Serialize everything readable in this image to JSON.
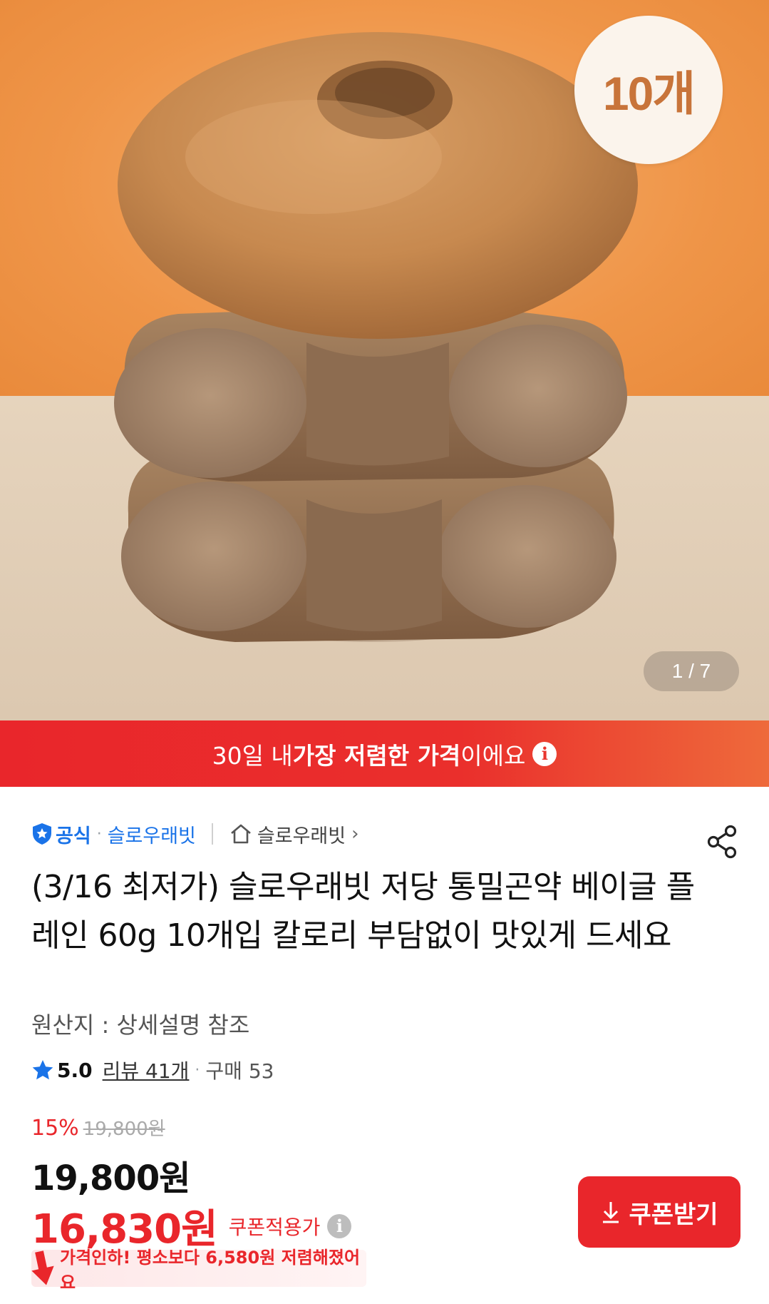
{
  "hero": {
    "count_badge": "10개",
    "page_indicator": "1 / 7"
  },
  "banner": {
    "text_before": "30일 내 ",
    "text_bold": "가장 저렴한 가격",
    "text_after": "이에요",
    "info_glyph": "i"
  },
  "store": {
    "official_label": "공식",
    "separator": "·",
    "store_name": "슬로우래빗",
    "home_store_name": "슬로우래빗",
    "chevron": "›"
  },
  "product": {
    "title": "(3/16 최저가) 슬로우래빗 저당 통밀곤약 베이글 플레인 60g 10개입 칼로리 부담없이 맛있게 드세요",
    "origin": "원산지 : 상세설명 참조"
  },
  "rating": {
    "score": "5.0",
    "review_link": "리뷰 41개",
    "separator": "·",
    "purchase_count": "구매 53"
  },
  "price": {
    "discount_rate": "15%",
    "original_price": "19,800원",
    "sale_price": "19,800원",
    "coupon_price": "16,830원",
    "coupon_label": "쿠폰적용가",
    "info_glyph": "i"
  },
  "coupon_button": {
    "label": "쿠폰받기"
  },
  "price_drop": {
    "text": "가격인하! 평소보다 6,580원 저렴해졌어요"
  },
  "icons": {
    "official": "shield-star-icon",
    "home": "home-icon",
    "share": "share-icon",
    "star": "star-icon",
    "download": "download-icon",
    "price_drop": "down-arrow-icon",
    "info": "info-icon"
  },
  "colors": {
    "accent_red": "#e9262b",
    "official_blue": "#1a73e8",
    "star_blue": "#1a73e8"
  }
}
